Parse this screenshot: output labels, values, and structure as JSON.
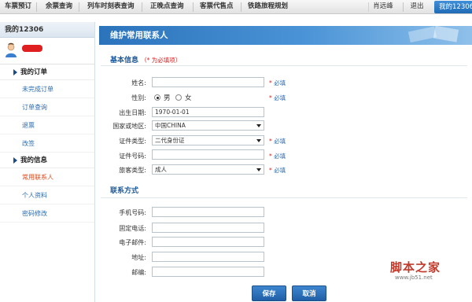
{
  "topnav": {
    "items": [
      "车票预订",
      "余票查询",
      "列车时刻表查询",
      "正晚点查询",
      "客票代售点",
      "铁路旅程规划"
    ],
    "user_name": "肖远峰",
    "logout_label": "退出",
    "my_label": "我的12306"
  },
  "sidebar": {
    "title": "我的12306",
    "orders_head": "我的订单",
    "order_items": [
      "未完成订单",
      "订单查询",
      "退票",
      "改签"
    ],
    "info_head": "我的信息",
    "info_items": [
      "常用联系人",
      "个人资料",
      "密码修改"
    ],
    "active_item": "常用联系人"
  },
  "main": {
    "banner_title": "维护常用联系人",
    "basic_section": {
      "title": "基本信息",
      "note": "（* 为必填项）"
    },
    "required_text": "必填",
    "required_star": "*",
    "fields": {
      "name": {
        "label": "姓名:",
        "value": ""
      },
      "gender": {
        "label": "性别:",
        "options": [
          "男",
          "女"
        ],
        "selected": "男"
      },
      "birthdate": {
        "label": "出生日期:",
        "value": "1970-01-01"
      },
      "country": {
        "label": "国家或地区:",
        "value": "中国CHINA"
      },
      "id_type": {
        "label": "证件类型:",
        "value": "二代身份证"
      },
      "id_number": {
        "label": "证件号码:",
        "value": ""
      },
      "passenger_type": {
        "label": "旅客类型:",
        "value": "成人"
      }
    },
    "contact_section": {
      "title": "联系方式"
    },
    "contact_fields": {
      "mobile": {
        "label": "手机号码:",
        "value": ""
      },
      "phone": {
        "label": "固定电话:",
        "value": ""
      },
      "email": {
        "label": "电子邮件:",
        "value": ""
      },
      "address": {
        "label": "地址:",
        "value": ""
      },
      "zip": {
        "label": "邮编:",
        "value": ""
      }
    },
    "buttons": {
      "save": "保存",
      "cancel": "取消"
    }
  },
  "watermark": {
    "title": "脚本之家",
    "url": "www.jb51.net"
  },
  "colors": {
    "accent": "#2b73bb",
    "required": "#e02020",
    "link": "#2b6cb3",
    "active": "#e34a1a"
  }
}
